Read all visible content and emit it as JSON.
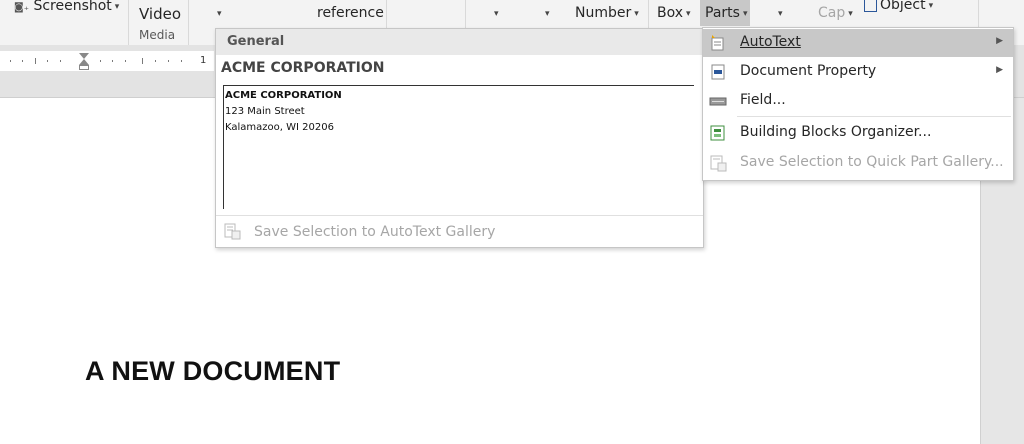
{
  "ribbon": {
    "screenshot_label": "Screenshot",
    "video_label": "Video",
    "media_group": "Media",
    "reference_label": "reference",
    "number_label": "Number",
    "box_label": "Box",
    "parts_label": "Parts",
    "cap_label": "Cap",
    "object_label": "Object"
  },
  "ruler": {
    "number": "1"
  },
  "document": {
    "heading": "A NEW DOCUMENT"
  },
  "gallery": {
    "category": "General",
    "entry_name": "ACME CORPORATION",
    "preview_lines": [
      "ACME CORPORATION",
      "123 Main Street",
      "Kalamazoo, WI 20206"
    ],
    "save_label": "Save Selection to AutoText Gallery"
  },
  "parts_menu": {
    "items": [
      {
        "label": "AutoText",
        "icon": "autotext-icon",
        "submenu": true,
        "highlighted": true
      },
      {
        "label": "Document Property",
        "icon": "document-property-icon",
        "submenu": true
      },
      {
        "label": "Field...",
        "icon": "field-icon"
      },
      {
        "label": "Building Blocks Organizer...",
        "icon": "building-blocks-icon"
      },
      {
        "label": "Save Selection to Quick Part Gallery...",
        "icon": "save-quickpart-icon",
        "disabled": true
      }
    ]
  },
  "colors": {
    "ribbon_bg": "#f3f3f3",
    "highlight": "#c8c8c8",
    "disabled_text": "#a6a6a6"
  }
}
